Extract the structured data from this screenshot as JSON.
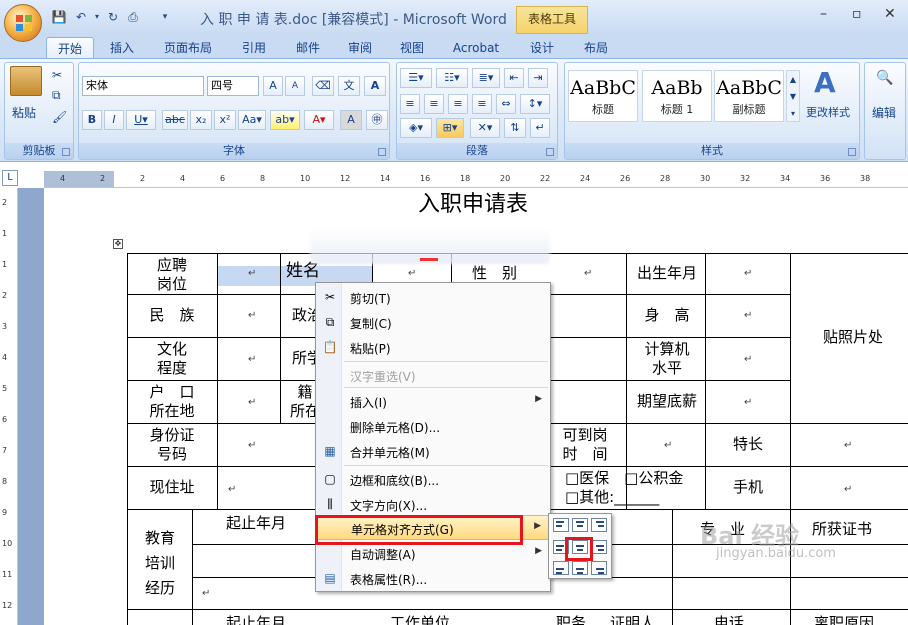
{
  "window": {
    "title": "入 职 申 请 表.doc [兼容模式] - Microsoft Word",
    "contextual_tab_group": "表格工具",
    "min": "–",
    "restore": "▫",
    "close": "✕"
  },
  "tabs": [
    "开始",
    "插入",
    "页面布局",
    "引用",
    "邮件",
    "审阅",
    "视图",
    "Acrobat",
    "设计",
    "布局"
  ],
  "ribbon": {
    "clipboard": {
      "paste": "粘贴",
      "label": "剪贴板"
    },
    "font": {
      "name": "宋体",
      "size": "四号",
      "label": "字体"
    },
    "paragraph": {
      "label": "段落"
    },
    "styles": {
      "label": "样式",
      "tiles": [
        {
          "sample": "AaBbC",
          "name": "标题"
        },
        {
          "sample": "AaBb",
          "name": "标题 1"
        },
        {
          "sample": "AaBbC",
          "name": "副标题"
        }
      ],
      "change_styles": "更改样式"
    },
    "editing": {
      "label": "编辑"
    }
  },
  "ruler": {
    "h_ticks": [
      "4",
      "2",
      "2",
      "4",
      "6",
      "8",
      "10",
      "12",
      "14",
      "16",
      "18",
      "20",
      "22",
      "24",
      "26",
      "28",
      "30",
      "32",
      "34",
      "36",
      "38"
    ],
    "v_ticks": [
      "2",
      "1",
      "1",
      "2",
      "3",
      "4",
      "5",
      "6",
      "7",
      "8",
      "9",
      "10",
      "11",
      "12"
    ]
  },
  "document": {
    "heading": "入职申请表",
    "cells": {
      "apply_pos": "应聘\n岗位",
      "name": "姓名",
      "gender": "性　别",
      "birth": "出生年月",
      "photo": "贴照片处",
      "nation": "民　族",
      "politics": "政治",
      "height": "身　高",
      "edu": "文化\n程度",
      "major": "所学",
      "computer": "计算机\n水平",
      "hukou": "户　口\n所在地",
      "native": "籍\n所在",
      "salary": "期望底薪",
      "idcard": "身份证\n号码",
      "arrival": "可到岗\n时　间",
      "specialty": "特长",
      "address": "现住址",
      "insurance_line1": "□医保　□公积金",
      "insurance_line2": "□其他:______",
      "mobile": "手机",
      "edu_hist": "教育\n培训\n经历",
      "period": "起止年月",
      "prof": "专　业",
      "cert": "所获证书",
      "bottom_period": "起止年月",
      "bottom_unit": "工作单位",
      "bottom_pos": "职务",
      "bottom_witness": "证明人",
      "bottom_phone": "电话",
      "bottom_reason": "离职原因",
      "mark": "↵"
    }
  },
  "context_menu": {
    "items": [
      {
        "label": "剪切(T)",
        "icon": "✂",
        "disabled": false,
        "submenu": false
      },
      {
        "label": "复制(C)",
        "icon": "⧉",
        "disabled": false,
        "submenu": false
      },
      {
        "label": "粘贴(P)",
        "icon": "📋",
        "disabled": false,
        "submenu": false
      },
      {
        "label": "汉字重选(V)",
        "icon": "",
        "disabled": true,
        "submenu": false
      },
      {
        "label": "插入(I)",
        "icon": "",
        "disabled": false,
        "submenu": true
      },
      {
        "label": "删除单元格(D)...",
        "icon": "",
        "disabled": false,
        "submenu": false
      },
      {
        "label": "合并单元格(M)",
        "icon": "▦",
        "disabled": false,
        "submenu": false
      },
      {
        "label": "边框和底纹(B)...",
        "icon": "▢",
        "disabled": false,
        "submenu": false
      },
      {
        "label": "文字方向(X)...",
        "icon": "⫼",
        "disabled": false,
        "submenu": false
      },
      {
        "label": "单元格对齐方式(G)",
        "icon": "",
        "disabled": false,
        "submenu": true
      },
      {
        "label": "自动调整(A)",
        "icon": "",
        "disabled": false,
        "submenu": true
      },
      {
        "label": "表格属性(R)...",
        "icon": "▤",
        "disabled": false,
        "submenu": false
      }
    ],
    "arrow": "▶"
  },
  "watermark": {
    "main": "Bai 经验",
    "sub": "jingyan.baidu.com"
  }
}
